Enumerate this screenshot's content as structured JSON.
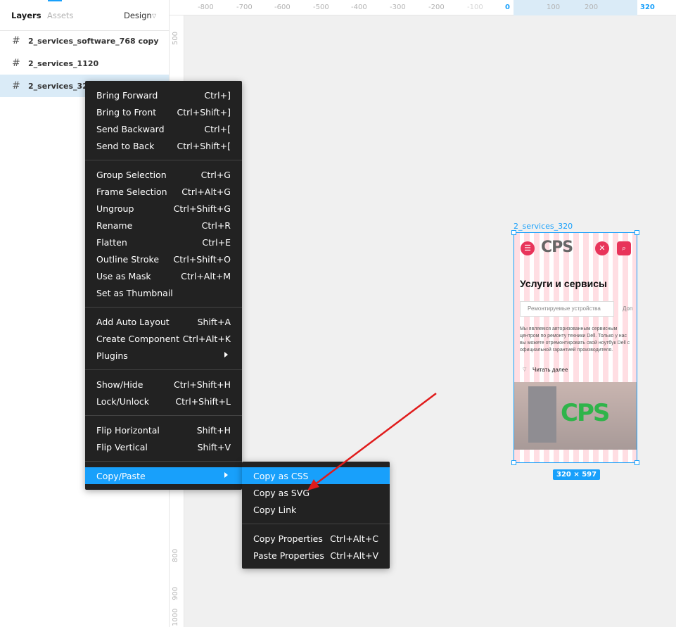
{
  "panel": {
    "tabs": {
      "layers": "Layers",
      "assets": "Assets",
      "design": "Design"
    },
    "layers": [
      {
        "name": "2_services_software_768 copy",
        "selected": false
      },
      {
        "name": "2_services_1120",
        "selected": false
      },
      {
        "name": "2_services_320",
        "selected": true
      }
    ]
  },
  "ruler": {
    "top": [
      "-800",
      "-700",
      "-600",
      "-500",
      "-400",
      "-300",
      "-200",
      "-100",
      "0",
      "100",
      "200",
      "320"
    ],
    "left": [
      "500",
      "800",
      "900",
      "1000"
    ]
  },
  "canvas": {
    "frame_label": "2_services_320",
    "frame_size": "320 × 597",
    "preview": {
      "logo": "CPS",
      "title": "Услуги и сервисы",
      "tab_label": "Ремонтируемые устройства",
      "tab_next": "Доп",
      "description": "Мы являемся авторизованным сервисным центром по ремонту техники Dell. Только у нас вы можете отремонтировать свой ноутбук Dell с официальной гарантией производителя.",
      "read_more": "Читать далее",
      "image_logo": "CPS"
    }
  },
  "context_menu": {
    "groups": [
      [
        {
          "label": "Bring Forward",
          "shortcut": "Ctrl+]"
        },
        {
          "label": "Bring to Front",
          "shortcut": "Ctrl+Shift+]"
        },
        {
          "label": "Send Backward",
          "shortcut": "Ctrl+["
        },
        {
          "label": "Send to Back",
          "shortcut": "Ctrl+Shift+["
        }
      ],
      [
        {
          "label": "Group Selection",
          "shortcut": "Ctrl+G"
        },
        {
          "label": "Frame Selection",
          "shortcut": "Ctrl+Alt+G"
        },
        {
          "label": "Ungroup",
          "shortcut": "Ctrl+Shift+G"
        },
        {
          "label": "Rename",
          "shortcut": "Ctrl+R"
        },
        {
          "label": "Flatten",
          "shortcut": "Ctrl+E"
        },
        {
          "label": "Outline Stroke",
          "shortcut": "Ctrl+Shift+O"
        },
        {
          "label": "Use as Mask",
          "shortcut": "Ctrl+Alt+M"
        },
        {
          "label": "Set as Thumbnail",
          "shortcut": ""
        }
      ],
      [
        {
          "label": "Add Auto Layout",
          "shortcut": "Shift+A"
        },
        {
          "label": "Create Component",
          "shortcut": "Ctrl+Alt+K"
        },
        {
          "label": "Plugins",
          "shortcut": "",
          "submenu": true
        }
      ],
      [
        {
          "label": "Show/Hide",
          "shortcut": "Ctrl+Shift+H"
        },
        {
          "label": "Lock/Unlock",
          "shortcut": "Ctrl+Shift+L"
        }
      ],
      [
        {
          "label": "Flip Horizontal",
          "shortcut": "Shift+H"
        },
        {
          "label": "Flip Vertical",
          "shortcut": "Shift+V"
        }
      ],
      [
        {
          "label": "Copy/Paste",
          "shortcut": "",
          "submenu": true,
          "active": true
        }
      ]
    ]
  },
  "submenu": {
    "groups": [
      [
        {
          "label": "Copy as CSS",
          "shortcut": "",
          "active": true
        },
        {
          "label": "Copy as SVG",
          "shortcut": ""
        },
        {
          "label": "Copy Link",
          "shortcut": ""
        }
      ],
      [
        {
          "label": "Copy Properties",
          "shortcut": "Ctrl+Alt+C"
        },
        {
          "label": "Paste Properties",
          "shortcut": "Ctrl+Alt+V"
        }
      ]
    ]
  },
  "colors": {
    "accent": "#18a0fb",
    "menu_bg": "#222222",
    "arrow": "#e01b1b",
    "brand_pink": "#e8345a",
    "brand_green": "#2fb44a"
  }
}
